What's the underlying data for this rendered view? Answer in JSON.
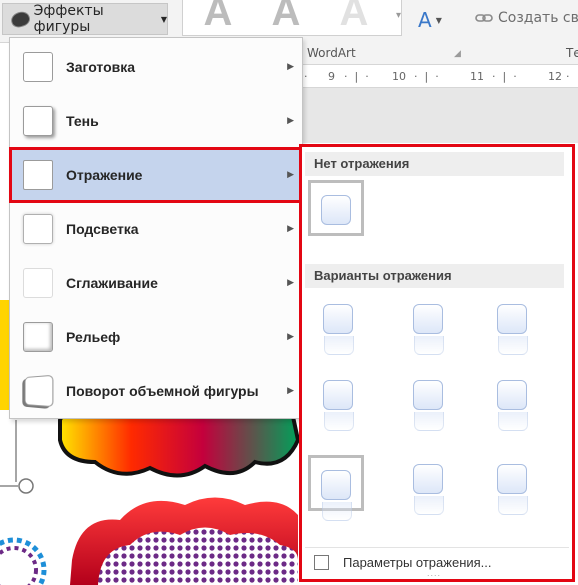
{
  "ribbon": {
    "effects_button_label": "Эффекты фигуры",
    "wordart_group_label": "WordArt",
    "text_group_label": "Текст",
    "create_link_label": "Создать свя",
    "wordart_glyph": "A",
    "text_color_glyph": "A"
  },
  "ruler": {
    "ticks": [
      "9",
      "10",
      "11",
      "12"
    ]
  },
  "menu": {
    "items": [
      {
        "label": "Заготовка",
        "icon": "preset-effect-icon"
      },
      {
        "label": "Тень",
        "icon": "shadow-effect-icon"
      },
      {
        "label": "Отражение",
        "icon": "reflection-effect-icon",
        "active": true
      },
      {
        "label": "Подсветка",
        "icon": "glow-effect-icon"
      },
      {
        "label": "Сглаживание",
        "icon": "soft-edges-effect-icon"
      },
      {
        "label": "Рельеф",
        "icon": "bevel-effect-icon"
      },
      {
        "label": "Поворот объемной фигуры",
        "icon": "3d-rotation-effect-icon"
      }
    ]
  },
  "submenu": {
    "no_reflection_header": "Нет отражения",
    "variants_header": "Варианты отражения",
    "options_link": "Параметры отражения...",
    "grip": "....",
    "selected_variant_row": 3,
    "selected_variant_col": 1
  },
  "colors": {
    "highlight": "#c5d4ed",
    "annotation_red": "#e30613",
    "accent_blue": "#3a78c9"
  }
}
